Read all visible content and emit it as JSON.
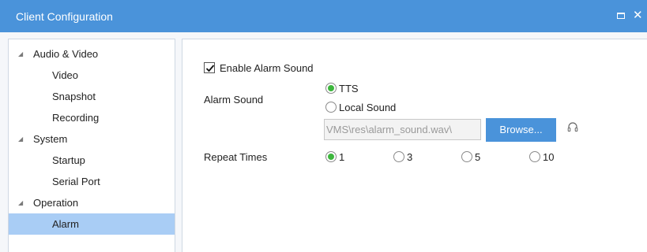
{
  "window": {
    "title": "Client Configuration",
    "title_bar_color": "#4a93da",
    "maximize_icon": "maximize-icon",
    "close_icon": "close-icon",
    "close_glyph": "✕"
  },
  "sidebar": {
    "selected_color": "#a9cdf5",
    "expand_icon": "triangle-expanded-icon",
    "groups": [
      {
        "label": "Audio & Video",
        "children": [
          "Video",
          "Snapshot",
          "Recording"
        ]
      },
      {
        "label": "System",
        "children": [
          "Startup",
          "Serial Port"
        ]
      },
      {
        "label": "Operation",
        "children": [
          "Alarm"
        ]
      }
    ],
    "selected_item": "Alarm"
  },
  "alarm": {
    "enable_label": "Enable Alarm Sound",
    "enable_checked": true,
    "alarm_sound_label": "Alarm Sound",
    "sound_options": [
      "TTS",
      "Local Sound"
    ],
    "sound_selected": "TTS",
    "file_path": "C:\\VMS\\res\\alarm_sound.wav",
    "file_path_visible": "\\VMS\\res\\alarm_sound.wav",
    "browse_label": "Browse...",
    "listen_icon": "headphones-icon",
    "repeat_label": "Repeat Times",
    "repeat_options": [
      "1",
      "3",
      "5",
      "10"
    ],
    "repeat_selected": "1",
    "radio_checked_color": "#3db63d",
    "accent_color": "#4a93da"
  }
}
